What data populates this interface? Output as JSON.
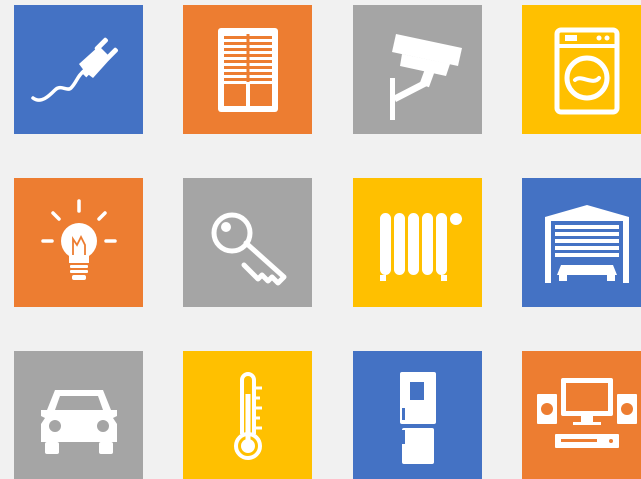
{
  "colors": {
    "background": "#f1f1f1",
    "blue": "#4472c4",
    "orange": "#ed7d31",
    "gray": "#a5a5a5",
    "yellow": "#ffc000",
    "icon": "#ffffff"
  },
  "tiles": [
    {
      "icon": "power-plug-icon",
      "color": "#4472c4"
    },
    {
      "icon": "window-blinds-icon",
      "color": "#ed7d31"
    },
    {
      "icon": "security-camera-icon",
      "color": "#a5a5a5"
    },
    {
      "icon": "washing-machine-icon",
      "color": "#ffc000"
    },
    {
      "icon": "light-bulb-icon",
      "color": "#ed7d31"
    },
    {
      "icon": "key-icon",
      "color": "#a5a5a5"
    },
    {
      "icon": "radiator-icon",
      "color": "#ffc000"
    },
    {
      "icon": "garage-door-icon",
      "color": "#4472c4"
    },
    {
      "icon": "car-icon",
      "color": "#a5a5a5"
    },
    {
      "icon": "thermometer-icon",
      "color": "#ffc000"
    },
    {
      "icon": "refrigerator-icon",
      "color": "#4472c4"
    },
    {
      "icon": "home-theater-icon",
      "color": "#ed7d31"
    }
  ]
}
